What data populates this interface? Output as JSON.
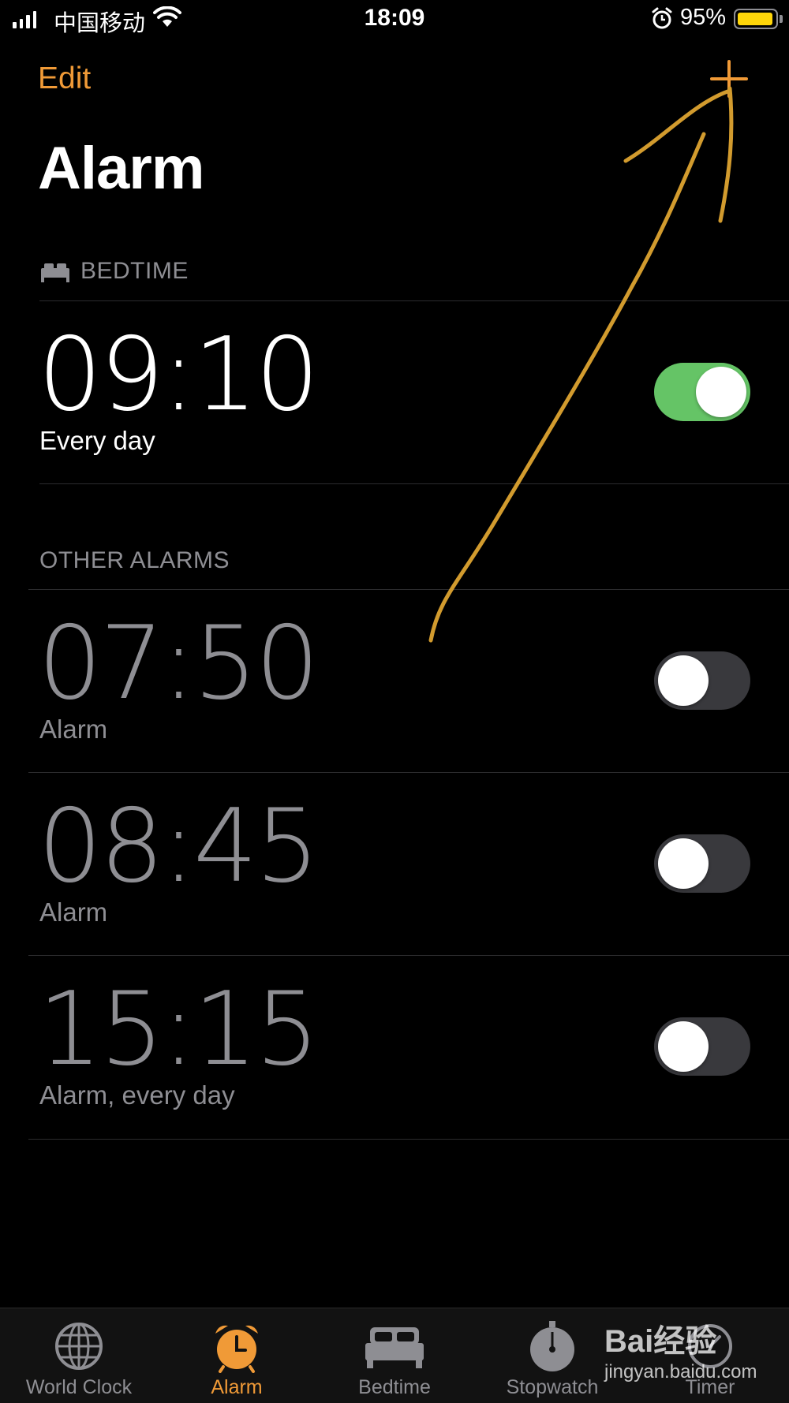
{
  "status_bar": {
    "carrier": "中国移动",
    "time": "18:09",
    "battery_percent": "95%",
    "battery_level": 0.95,
    "battery_color": "#ffd60a",
    "icons": [
      "signal-icon",
      "wifi-icon",
      "alarm-indicator-icon",
      "battery-icon"
    ]
  },
  "nav": {
    "edit_label": "Edit",
    "add_icon": "plus-icon",
    "title": "Alarm",
    "accent_color": "#f09a37"
  },
  "bedtime": {
    "header": "BEDTIME",
    "icon": "bed-icon",
    "alarm": {
      "time": "09:10",
      "label": "Every day",
      "enabled": true
    }
  },
  "other_alarms": {
    "header": "OTHER ALARMS",
    "items": [
      {
        "time": "07:50",
        "label": "Alarm",
        "enabled": false
      },
      {
        "time": "08:45",
        "label": "Alarm",
        "enabled": false
      },
      {
        "time": "15:15",
        "label": "Alarm, every day",
        "enabled": false
      }
    ]
  },
  "tab_bar": {
    "tabs": [
      {
        "label": "World Clock",
        "icon": "globe-icon",
        "active": false
      },
      {
        "label": "Alarm",
        "icon": "alarm-clock-icon",
        "active": true
      },
      {
        "label": "Bedtime",
        "icon": "bed-icon",
        "active": false
      },
      {
        "label": "Stopwatch",
        "icon": "stopwatch-icon",
        "active": false
      },
      {
        "label": "Timer",
        "icon": "timer-icon",
        "active": false
      }
    ]
  },
  "toggle_colors": {
    "on": "#65c466",
    "off": "#39393d"
  },
  "watermark": {
    "brand": "Bai经验",
    "url": "jingyan.baidu.com"
  }
}
